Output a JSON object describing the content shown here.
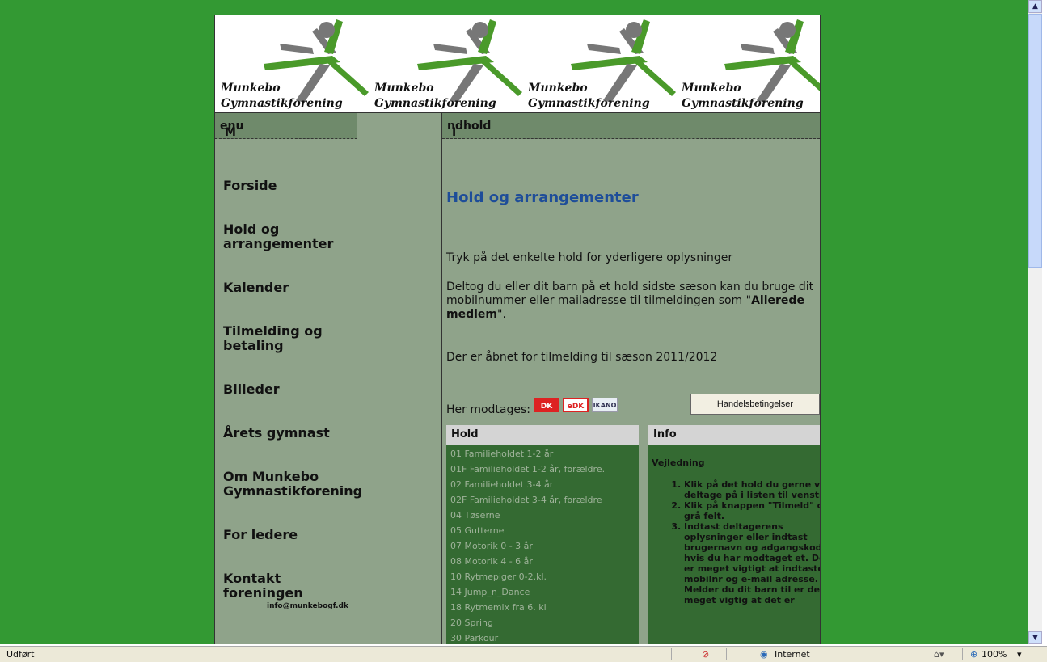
{
  "banner": {
    "logo_line1": "Munkebo",
    "logo_line2": "Gymnastikforening",
    "colors": {
      "green": "#4a9a2a",
      "gray": "#777777"
    }
  },
  "menu": {
    "heading_cap": "M",
    "heading_rest": "enu",
    "items": [
      {
        "label": "Forside"
      },
      {
        "label": "Hold og arrangementer"
      },
      {
        "label": "Kalender"
      },
      {
        "label": "Tilmelding og betaling"
      },
      {
        "label": "Billeder"
      },
      {
        "label": "Årets gymnast"
      },
      {
        "label": "Om Munkebo Gymnastikforening"
      },
      {
        "label": "For ledere"
      },
      {
        "label": "Kontakt foreningen"
      }
    ],
    "email": "info@munkebogf.dk"
  },
  "content": {
    "heading_cap": "I",
    "heading_rest": "ndhold",
    "title": "Hold og arrangementer",
    "intro": "Tryk på det enkelte hold for yderligere oplysninger",
    "para_pre": "Deltog du eller dit barn på et hold sidste sæson kan du bruge dit mobilnummer eller mailadresse til tilmeldingen som \"",
    "para_bold": "Allerede medlem",
    "para_post": "\".",
    "season": "Der er åbnet for tilmelding til sæson 2011/2012",
    "payment_label": "Her modtages:",
    "cards": [
      "DK",
      "eDK",
      "IKANO"
    ],
    "terms_button": "Handelsbetingelser"
  },
  "hold_table": {
    "header": "Hold",
    "items": [
      "01 Familieholdet 1-2 år",
      "01F Familieholdet 1-2 år, forældre.",
      "02 Familieholdet 3-4 år",
      "02F Familieholdet 3-4 år, forældre",
      "04 Tøserne",
      "05 Gutterne",
      "07 Motorik 0 - 3 år",
      "08 Motorik 4 - 6 år",
      "10 Rytmepiger 0-2.kl.",
      "14 Jump_n_Dance",
      "18 Rytmemix fra 6. kl",
      "20 Spring",
      "30 Parkour"
    ]
  },
  "info_table": {
    "header": "Info",
    "title": "Vejledning",
    "steps": [
      "Klik på det hold du gerne vil deltage på i listen til venstre.",
      "Klik på knappen \"Tilmeld\" det grå felt.",
      "Indtast deltagerens oplysninger eller indtast brugernavn og adgangskode, hvis du har modtaget et. Det er meget vigtigt at indtaste mobilnr og e-mail adresse. Melder du dit barn til er det meget vigtig at det er"
    ]
  },
  "status_bar": {
    "status": "Udført",
    "zone": "Internet",
    "zoom": "100%"
  }
}
